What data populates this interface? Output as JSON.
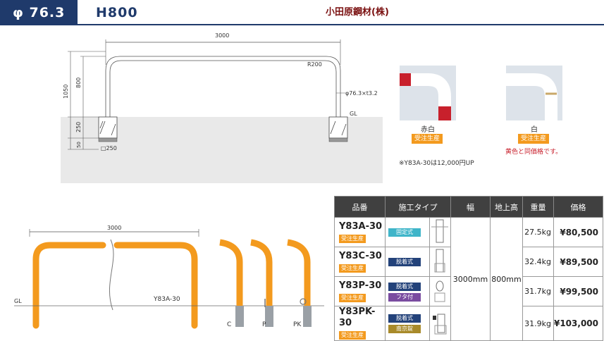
{
  "header": {
    "diameter": "φ 76.3",
    "height_code": "H800",
    "maker": "小田原鋼材(株)"
  },
  "drawing": {
    "width_dim": "3000",
    "radius": "R200",
    "pipe": "φ76.3×t3.2",
    "gl": "GL",
    "height_total": "1050",
    "height_above": "800",
    "depth": "250",
    "base": "50",
    "footing": "□250"
  },
  "photos": {
    "red_white": {
      "label": "赤白",
      "badge": "受注生産"
    },
    "white": {
      "label": "白",
      "badge": "受注生産"
    },
    "yellow_note": "黄色と同価格です。",
    "price_note": "※Y83A-30は12,000円UP"
  },
  "illustration": {
    "width_dim": "3000",
    "model": "Y83A-30",
    "gl": "GL",
    "variants": [
      "C",
      "P",
      "PK"
    ]
  },
  "table": {
    "headers": [
      "品番",
      "施工タイプ",
      "幅",
      "地上高",
      "重量",
      "価格"
    ],
    "rows": [
      {
        "code": "Y83A-30",
        "badge": "受注生産",
        "types": [
          {
            "label": "固定式",
            "color": "cyan"
          }
        ],
        "weight": "27.5kg",
        "price": "¥80,500"
      },
      {
        "code": "Y83C-30",
        "badge": "受注生産",
        "types": [
          {
            "label": "脱着式",
            "color": "navy"
          }
        ],
        "weight": "32.4kg",
        "price": "¥89,500"
      },
      {
        "code": "Y83P-30",
        "badge": "受注生産",
        "types": [
          {
            "label": "脱着式",
            "color": "navy"
          },
          {
            "label": "フタ付",
            "color": "purple"
          }
        ],
        "weight": "31.7kg",
        "price": "¥99,500"
      },
      {
        "code": "Y83PK-30",
        "badge": "受注生産",
        "types": [
          {
            "label": "脱着式",
            "color": "navy"
          },
          {
            "label": "南京錠",
            "color": "gold"
          }
        ],
        "weight": "31.9kg",
        "price": "¥103,000"
      }
    ],
    "width": "3000mm",
    "ground_height": "800mm"
  },
  "colors": {
    "navy": "#1f3a6b",
    "orange": "#f39a1e",
    "red": "#c8202c"
  }
}
